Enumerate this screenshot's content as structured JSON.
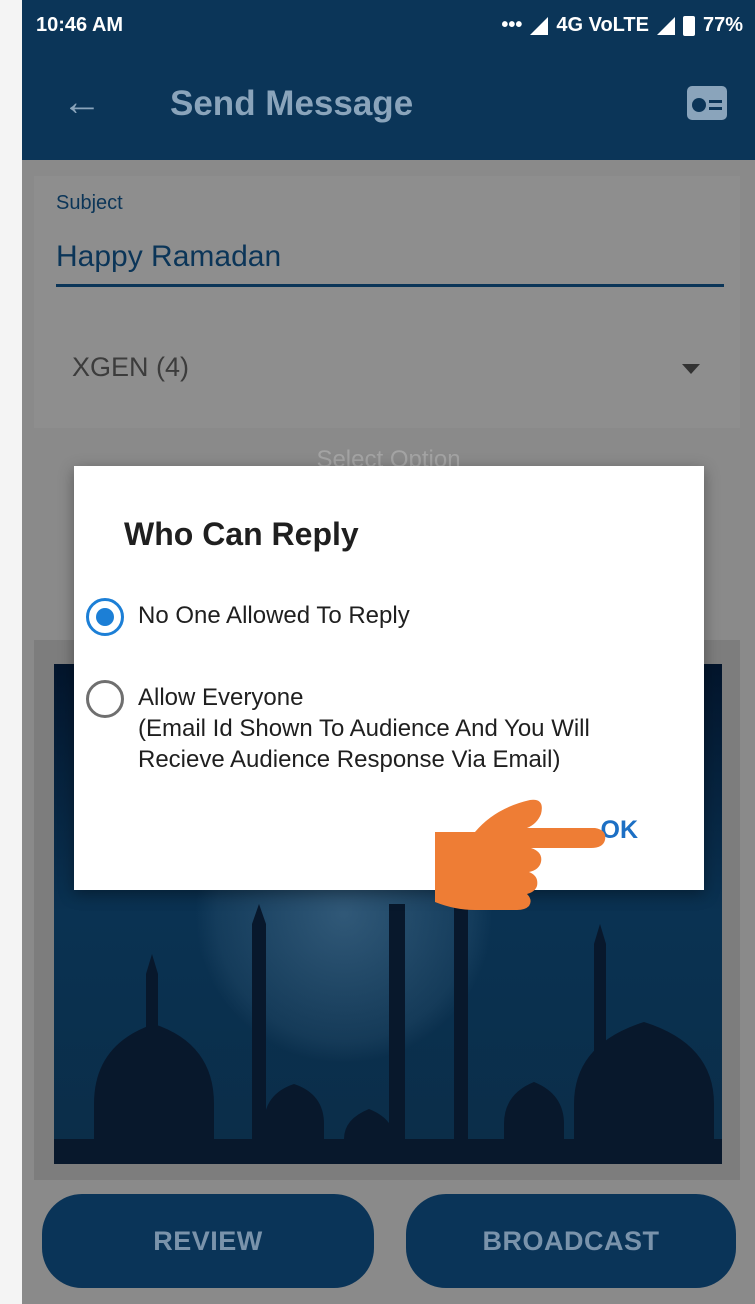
{
  "statusbar": {
    "time": "10:46 AM",
    "network": "4G VoLTE",
    "battery": "77%"
  },
  "appbar": {
    "title": "Send Message"
  },
  "form": {
    "subject_label": "Subject",
    "subject_value": "Happy Ramadan",
    "group_value": "XGEN (4)",
    "select_option_text": "Select Option"
  },
  "dialog": {
    "title": "Who Can Reply",
    "options": [
      {
        "label": "No One Allowed To Reply",
        "selected": true
      },
      {
        "label": "Allow Everyone",
        "detail_line1": "(Email Id Shown To Audience And You Will",
        "detail_line2": "Recieve Audience Response Via Email)",
        "selected": false
      }
    ],
    "ok_label": "OK"
  },
  "buttons": {
    "review": "REVIEW",
    "broadcast": "BROADCAST"
  },
  "colors": {
    "app_bar": "#0b3558",
    "accent": "#1c7fd6",
    "pointer": "#ee7d35"
  },
  "icons": [
    "back-arrow-icon",
    "radio-icon",
    "dropdown-arrow-icon",
    "pointing-hand-icon"
  ]
}
